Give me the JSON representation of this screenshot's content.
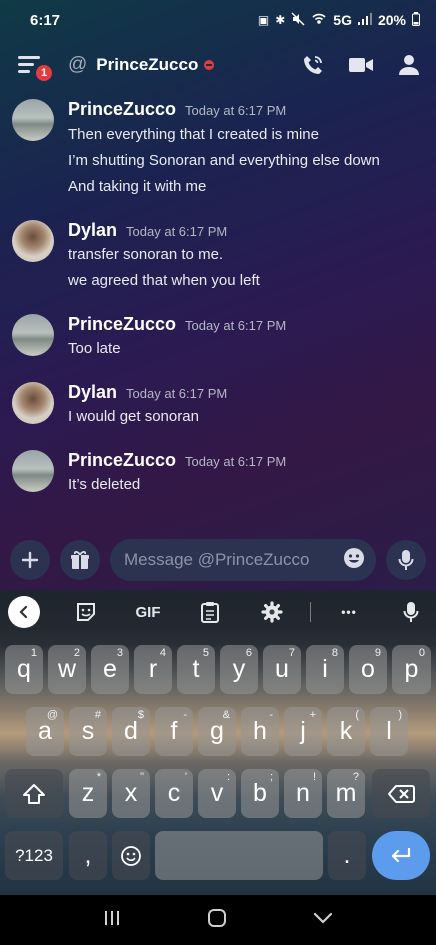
{
  "status_bar": {
    "time": "6:17",
    "network": "5G",
    "battery": "20%"
  },
  "header": {
    "badge_count": "1",
    "title": "PrinceZucco",
    "icons": [
      "menu-icon",
      "at-icon",
      "dnd-status-icon",
      "call-icon",
      "video-icon",
      "members-icon"
    ]
  },
  "messages": [
    {
      "author": "PrinceZucco",
      "timestamp": "Today at 6:17 PM",
      "lines": [
        "Then everything that I created is mine",
        "I’m shutting Sonoran and everything else down",
        "And taking it with me"
      ]
    },
    {
      "author": "Dylan",
      "timestamp": "Today at 6:17 PM",
      "lines": [
        "transfer sonoran to me.",
        "we agreed that when you left"
      ]
    },
    {
      "author": "PrinceZucco",
      "timestamp": "Today at 6:17 PM",
      "lines": [
        "Too late"
      ]
    },
    {
      "author": "Dylan",
      "timestamp": "Today at 6:17 PM",
      "lines": [
        "I would get sonoran"
      ]
    },
    {
      "author": "PrinceZucco",
      "timestamp": "Today at 6:17 PM",
      "lines": [
        "It’s deleted"
      ]
    }
  ],
  "composer": {
    "placeholder": "Message @PrinceZucco"
  },
  "keyboard": {
    "toolbar": {
      "gif_label": "GIF",
      "more_label": "•••"
    },
    "row1": [
      {
        "k": "q",
        "h": "1"
      },
      {
        "k": "w",
        "h": "2"
      },
      {
        "k": "e",
        "h": "3"
      },
      {
        "k": "r",
        "h": "4"
      },
      {
        "k": "t",
        "h": "5"
      },
      {
        "k": "y",
        "h": "6"
      },
      {
        "k": "u",
        "h": "7"
      },
      {
        "k": "i",
        "h": "8"
      },
      {
        "k": "o",
        "h": "9"
      },
      {
        "k": "p",
        "h": "0"
      }
    ],
    "row2": [
      {
        "k": "a",
        "h": "@"
      },
      {
        "k": "s",
        "h": "#"
      },
      {
        "k": "d",
        "h": "$"
      },
      {
        "k": "f",
        "h": "-"
      },
      {
        "k": "g",
        "h": "&"
      },
      {
        "k": "h",
        "h": "-"
      },
      {
        "k": "j",
        "h": "+"
      },
      {
        "k": "k",
        "h": "("
      },
      {
        "k": "l",
        "h": ")"
      }
    ],
    "row3": [
      {
        "k": "z",
        "h": "*"
      },
      {
        "k": "x",
        "h": "\""
      },
      {
        "k": "c",
        "h": "'"
      },
      {
        "k": "v",
        "h": ":"
      },
      {
        "k": "b",
        "h": ";"
      },
      {
        "k": "n",
        "h": "!"
      },
      {
        "k": "m",
        "h": "?"
      }
    ],
    "symbols_label": "?123",
    "comma_label": ",",
    "period_label": "."
  }
}
